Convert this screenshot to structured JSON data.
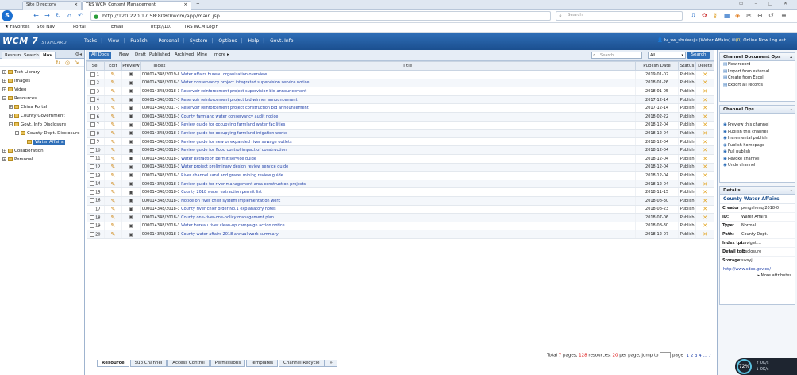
{
  "browser": {
    "tabs": [
      {
        "label": "Site Directory",
        "active": false
      },
      {
        "label": "TRS WCM Content Management",
        "active": true
      }
    ],
    "new_tab": "+",
    "window_controls": "▭ – ▢ ✕",
    "url": "http://120.220.17.58:8080/wcm/app/main.jsp",
    "search_placeholder": "Search",
    "bookmarks": [
      "★ Favorites",
      "Site Nav",
      "Portal",
      "Email",
      "http://10.",
      "TRS WCM Login"
    ]
  },
  "wcm": {
    "logo": "WCM 7",
    "logo_sub": "STANDARD",
    "menu": [
      "Tasks",
      "View",
      "Publish",
      "Personal",
      "System",
      "Options",
      "Help",
      "Govt. Info"
    ],
    "user": "lv_zw_shuiwuju",
    "user_role": "(Water Affairs)",
    "msg_count": "(0)",
    "current_label": "Online Now",
    "logout": "Log out"
  },
  "left": {
    "tabs": [
      "Resource",
      "Search",
      "Nav"
    ],
    "tree": [
      {
        "label": "Text Library",
        "level": 0,
        "exp": "+"
      },
      {
        "label": "Images",
        "level": 0,
        "exp": "+"
      },
      {
        "label": "Video",
        "level": 0,
        "exp": "+"
      },
      {
        "label": "Resources",
        "level": 0,
        "exp": "−"
      },
      {
        "label": "China Portal",
        "level": 1,
        "exp": "+"
      },
      {
        "label": "County Government",
        "level": 1,
        "exp": "+"
      },
      {
        "label": "Govt. Info Disclosure",
        "level": 1,
        "exp": "−"
      },
      {
        "label": "County Dept. Disclosure",
        "level": 2,
        "exp": "−"
      },
      {
        "label": "Water Affairs",
        "level": 3,
        "exp": "",
        "sel": true
      },
      {
        "label": "Collaboration",
        "level": 0,
        "exp": "+"
      },
      {
        "label": "Personal",
        "level": 0,
        "exp": "+"
      }
    ]
  },
  "toolbar": {
    "items": [
      "All Docs",
      "New",
      "Draft",
      "Published",
      "Archived",
      "Mine",
      "more ▸"
    ],
    "search_placeholder": "Search",
    "select_value": "All",
    "search_btn": "Search"
  },
  "table": {
    "headers": [
      "Sel",
      "Edit",
      "Preview",
      "Index",
      "Title",
      "Publish Date",
      "Status",
      "Delete"
    ],
    "rows": [
      {
        "n": "1",
        "idx": "000014348/2019-00030",
        "title": "Water affairs bureau organization overview",
        "date": "2019-01-02",
        "st": "Published"
      },
      {
        "n": "2",
        "idx": "000014348/2018-36446",
        "title": "Water conservancy project integrated supervision service notice",
        "date": "2018-01-26",
        "st": "Published"
      },
      {
        "n": "3",
        "idx": "000014348/2018-36442",
        "title": "Reservoir reinforcement project supervision bid announcement",
        "date": "2018-01-05",
        "st": "Published"
      },
      {
        "n": "4",
        "idx": "000014348/2017-36096",
        "title": "Reservoir reinforcement project bid winner announcement",
        "date": "2017-12-14",
        "st": "Published"
      },
      {
        "n": "5",
        "idx": "000014348/2017-36095",
        "title": "Reservoir reinforcement project construction bid announcement",
        "date": "2017-12-14",
        "st": "Published"
      },
      {
        "n": "6",
        "idx": "000014348/2018-36423",
        "title": "County farmland water conservancy audit notice",
        "date": "2018-02-22",
        "st": "Published"
      },
      {
        "n": "7",
        "idx": "000014348/2018-36401",
        "title": "Review guide for occupying farmland water facilities",
        "date": "2018-12-04",
        "st": "Published"
      },
      {
        "n": "8",
        "idx": "000014348/2018-36400",
        "title": "Review guide for occupying farmland irrigation works",
        "date": "2018-12-04",
        "st": "Published"
      },
      {
        "n": "9",
        "idx": "000014348/2018-36399",
        "title": "Review guide for new or expanded river sewage outlets",
        "date": "2018-12-04",
        "st": "Published"
      },
      {
        "n": "10",
        "idx": "000014348/2018-36397",
        "title": "Review guide for flood control impact of construction",
        "date": "2018-12-04",
        "st": "Published"
      },
      {
        "n": "11",
        "idx": "000014348/2018-36395",
        "title": "Water extraction permit service guide",
        "date": "2018-12-04",
        "st": "Published"
      },
      {
        "n": "12",
        "idx": "000014348/2018-36382",
        "title": "Water project preliminary design review service guide",
        "date": "2018-12-04",
        "st": "Published"
      },
      {
        "n": "13",
        "idx": "000014348/2018-36379",
        "title": "River channel sand and gravel mining review guide",
        "date": "2018-12-04",
        "st": "Published"
      },
      {
        "n": "14",
        "idx": "000014348/2018-36375",
        "title": "Review guide for river management area construction projects",
        "date": "2018-12-04",
        "st": "Published"
      },
      {
        "n": "15",
        "idx": "000014348/2018-36298",
        "title": "County 2018 water extraction permit list",
        "date": "2018-11-15",
        "st": "Published"
      },
      {
        "n": "16",
        "idx": "000014348/2018-36096",
        "title": "Notice on river chief system implementation work",
        "date": "2018-08-30",
        "st": "Published"
      },
      {
        "n": "17",
        "idx": "000014348/2018-36093",
        "title": "County river chief order No.1 explanatory notes",
        "date": "2018-08-23",
        "st": "Published"
      },
      {
        "n": "18",
        "idx": "000014348/2018-36074",
        "title": "County one-river-one-policy management plan",
        "date": "2018-07-06",
        "st": "Published"
      },
      {
        "n": "19",
        "idx": "000014348/2018-36067",
        "title": "Water bureau river clean-up campaign action notice",
        "date": "2018-08-30",
        "st": "Published"
      },
      {
        "n": "20",
        "idx": "000014348/2018-36451",
        "title": "County water affairs 2018 annual work summary",
        "date": "2018-12-07",
        "st": "Published"
      }
    ]
  },
  "pager": {
    "total_label": "Total",
    "pages": "7",
    "pages_label": "pages,",
    "docs": "128",
    "docs_label": "resources,",
    "per": "20",
    "per_label": "per page, jump to",
    "go": "page",
    "links": "1  2  3  4 ... 7"
  },
  "bottom_tabs": [
    "Resource",
    "Sub Channel",
    "Access Control",
    "Permissions",
    "Templates",
    "Channel Recycle"
  ],
  "right": {
    "doc_ops_title": "Channel Document Ops",
    "doc_ops": [
      "New record",
      "Import from external",
      "Create from Excel",
      "Export all records"
    ],
    "ch_ops_title": "Channel Ops",
    "ch_ops": [
      "Preview this channel",
      "Publish this channel",
      "Incremental publish",
      "Publish homepage",
      "Full publish",
      "Revoke channel",
      "Undo channel"
    ],
    "detail_title": "Details",
    "detail_name": "County Water Affairs",
    "detail_rows": [
      {
        "k": "Creator",
        "v": "pengshenq 2018-0"
      },
      {
        "k": "ID:",
        "v": "Water Affairs"
      },
      {
        "k": "Type:",
        "v": "Normal"
      },
      {
        "k": "Path:",
        "v": "County Dept."
      },
      {
        "k": "Index tpl:",
        "v": "navigati..."
      },
      {
        "k": "Detail tpl:",
        "v": "disclosure"
      },
      {
        "k": "Storage:",
        "v": "swsyj"
      }
    ],
    "detail_link": "http://www.sdxx.gov.cn/",
    "more_attrs": "More attributes"
  },
  "overlay": {
    "percent": "72%",
    "up": "0K/s",
    "down": "0K/s"
  }
}
